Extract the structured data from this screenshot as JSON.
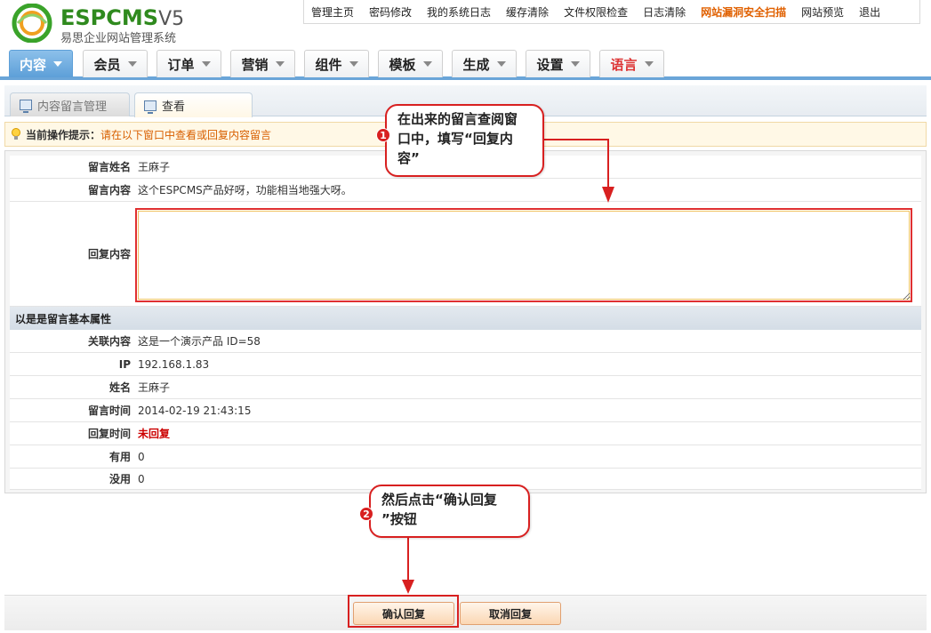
{
  "logo": {
    "brand_prefix": "ESP",
    "brand_mid": "CMS",
    "brand_version": "V5",
    "subtitle": "易思企业网站管理系统"
  },
  "topnav": [
    "管理主页",
    "密码修改",
    "我的系统日志",
    "缓存清除",
    "文件权限检查",
    "日志清除",
    "网站漏洞安全扫描",
    "网站预览",
    "退出"
  ],
  "mainmenu": [
    "内容",
    "会员",
    "订单",
    "营销",
    "组件",
    "模板",
    "生成",
    "设置",
    "语言"
  ],
  "subtabs": [
    "内容留言管理",
    "查看"
  ],
  "tip": {
    "label": "当前操作提示：",
    "text": "请在以下窗口中查看或回复内容留言"
  },
  "form": {
    "name_label": "留言姓名",
    "name_value": "王麻子",
    "content_label": "留言内容",
    "content_value": "这个ESPCMS产品好呀，功能相当地强大呀。",
    "reply_label": "回复内容",
    "reply_value": "",
    "section_title": "以是是留言基本属性",
    "related_label": "关联内容",
    "related_value": "这是一个演示产品 ID=58",
    "ip_label": "IP",
    "ip_value": "192.168.1.83",
    "person_label": "姓名",
    "person_value": "王麻子",
    "time_label": "留言时间",
    "time_value": "2014-02-19 21:43:15",
    "reply_time_label": "回复时间",
    "reply_time_value": "未回复",
    "useful_label": "有用",
    "useful_value": "0",
    "useless_label": "没用",
    "useless_value": "0"
  },
  "callouts": {
    "step1_number": "1",
    "step1_line1": "在出来的留言查阅窗",
    "step1_line2": "口中，填写“回复内",
    "step1_line3": "容”",
    "step2_number": "2",
    "step2_line1": "然后点击“确认回复",
    "step2_line2": "”按钮"
  },
  "buttons": {
    "confirm": "确认回复",
    "cancel": "取消回复"
  },
  "colors": {
    "accent_blue": "#5d9fd8",
    "warning_orange": "#e06000",
    "annotation_red": "#d82020"
  }
}
